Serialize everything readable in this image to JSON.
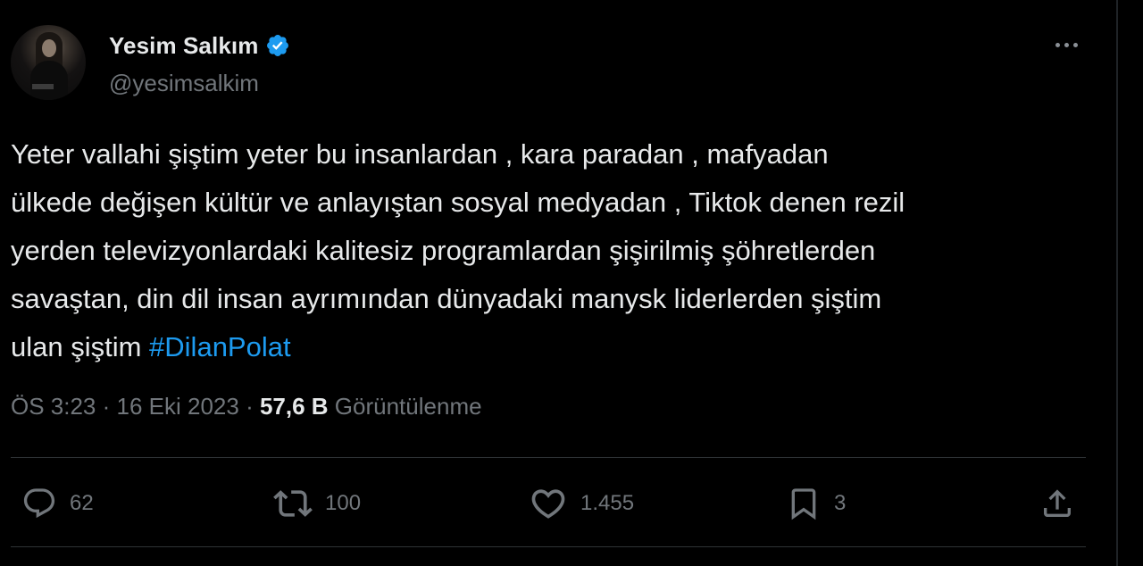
{
  "author": {
    "display_name": "Yesim Salkım",
    "handle": "@yesimsalkim",
    "verified_icon": "verified-badge-icon",
    "avatar_icon": "profile-photo"
  },
  "tweet": {
    "text_lines": [
      "Yeter vallahi şiştim yeter bu insanlardan , kara paradan , mafyadan",
      "ülkede değişen kültür ve anlayıştan sosyal medyadan , Tiktok denen rezil",
      "yerden televizyonlardaki kalitesiz programlardan şişirilmiş şöhretlerden",
      "savaştan, din dil insan ayrımından dünyadaki manysk liderlerden şiştim",
      "ulan şiştim "
    ],
    "hashtag": "#DilanPolat"
  },
  "meta": {
    "time": "ÖS 3:23",
    "separator": " · ",
    "date": "16 Eki 2023",
    "views_count": "57,6 B",
    "views_label": "Görüntülenme"
  },
  "actions": {
    "reply_count": "62",
    "retweet_count": "100",
    "like_count": "1.455",
    "bookmark_count": "3"
  },
  "colors": {
    "background": "#000000",
    "text": "#e7e9ea",
    "secondary": "#71767b",
    "accent": "#1d9bf0",
    "divider": "#2f3336"
  }
}
